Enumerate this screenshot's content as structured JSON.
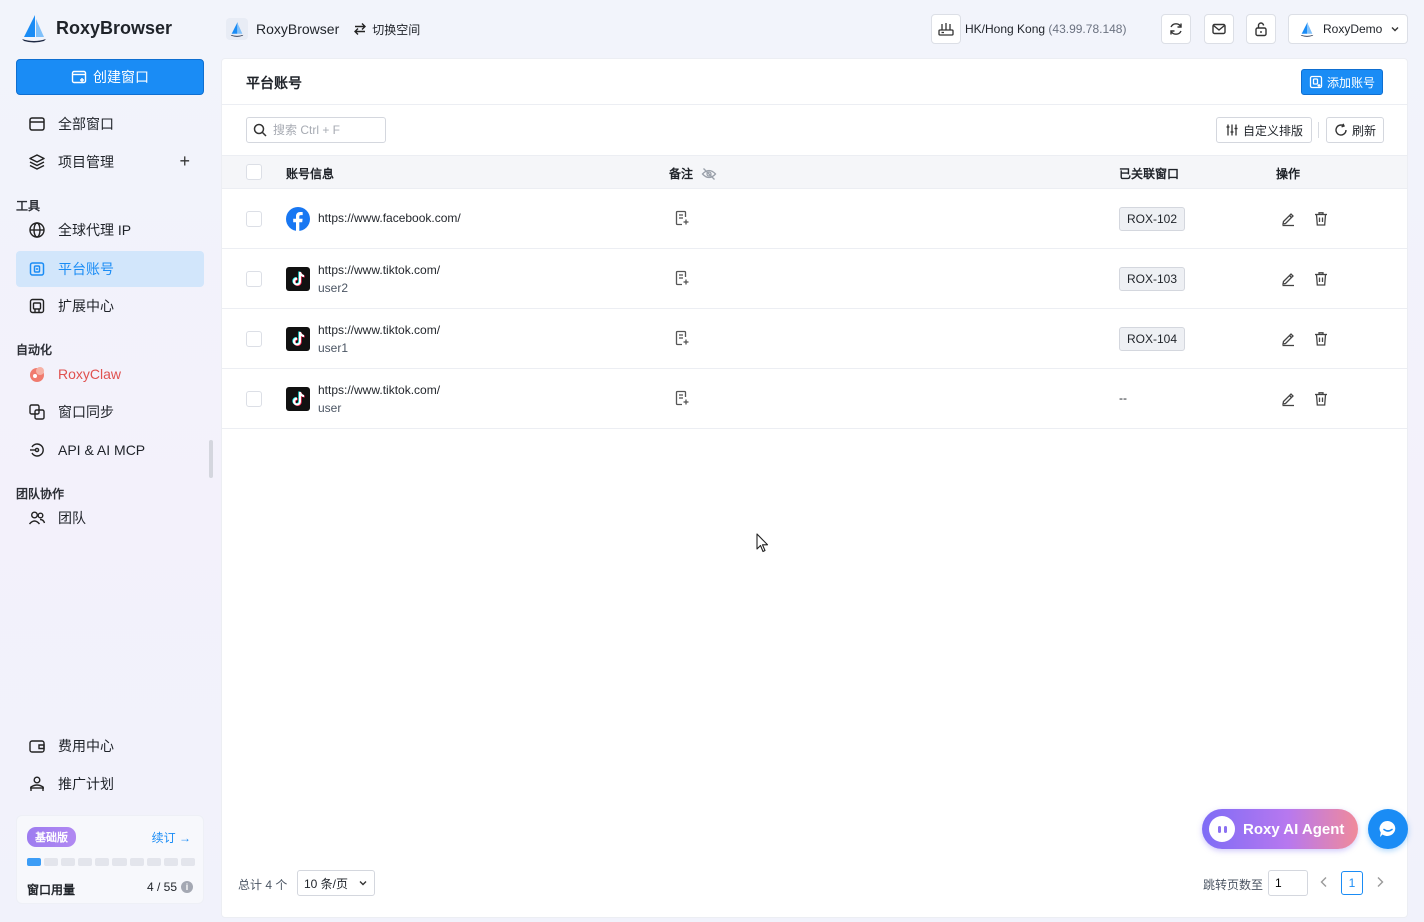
{
  "app": {
    "name": "RoxyBrowser"
  },
  "sidebar": {
    "create_label": "创建窗口",
    "items_main": [
      {
        "label": "全部窗口"
      },
      {
        "label": "项目管理"
      }
    ],
    "section_tools": "工具",
    "items_tools": [
      {
        "label": "全球代理 IP"
      },
      {
        "label": "平台账号"
      },
      {
        "label": "扩展中心"
      }
    ],
    "section_auto": "自动化",
    "items_auto": [
      {
        "label": "RoxyClaw"
      },
      {
        "label": "窗口同步"
      },
      {
        "label": "API & AI MCP"
      }
    ],
    "section_team": "团队协作",
    "items_team": [
      {
        "label": "团队"
      }
    ],
    "items_bottom": [
      {
        "label": "费用中心"
      },
      {
        "label": "推广计划"
      }
    ],
    "plan": {
      "badge": "基础版",
      "renew": "续订 →",
      "usage_label": "窗口用量",
      "usage_value": "4 / 55",
      "usage_fraction": 0.07
    }
  },
  "topbar": {
    "workspace": "RoxyBrowser",
    "switch_label": "切换空间",
    "ip_location": "HK/Hong Kong",
    "ip_address": "(43.99.78.148)",
    "user": "RoxyDemo"
  },
  "page": {
    "title": "平台账号",
    "add_label": "添加账号",
    "search_placeholder": "搜索 Ctrl + F",
    "custom_sort_label": "自定义排版",
    "refresh_label": "刷新",
    "columns": {
      "account": "账号信息",
      "note": "备注",
      "linked": "已关联窗口",
      "action": "操作"
    },
    "rows": [
      {
        "platform": "facebook",
        "url": "https://www.facebook.com/",
        "user": "",
        "window": "ROX-102"
      },
      {
        "platform": "tiktok",
        "url": "https://www.tiktok.com/",
        "user": "user2",
        "window": "ROX-103"
      },
      {
        "platform": "tiktok",
        "url": "https://www.tiktok.com/",
        "user": "user1",
        "window": "ROX-104"
      },
      {
        "platform": "tiktok",
        "url": "https://www.tiktok.com/",
        "user": "user",
        "window": "--"
      }
    ],
    "footer": {
      "total": "总计 4 个",
      "page_size": "10 条/页",
      "jump_label": "跳转页数至",
      "jump_value": "1",
      "current_page": "1"
    }
  },
  "floating": {
    "agent_label": "Roxy AI Agent"
  },
  "colors": {
    "accent": "#1a8cf5",
    "claw": "#e0514f",
    "facebook": "#1877f2"
  }
}
